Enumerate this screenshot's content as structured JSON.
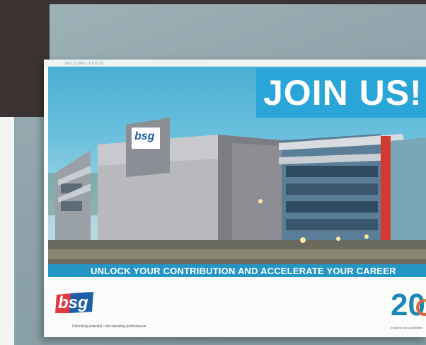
{
  "header": {
    "text": "WELCOME | JOIN US"
  },
  "hero": {
    "title": "JOIN US!"
  },
  "building_sign": {
    "text": "bsg"
  },
  "banner": {
    "text": "UNLOCK YOUR CONTRIBUTION AND ACCELERATE YOUR CAREER"
  },
  "logo": {
    "text": "bsg"
  },
  "tagline": {
    "text": "Unlocking potential » Accelerating performance"
  },
  "anniversary": {
    "text": "20",
    "subtext": "Enabling new possibilities"
  },
  "colors": {
    "brand_blue": "#2aa5d8",
    "banner_blue": "#2496c6",
    "logo_red": "#e03a3e",
    "logo_blue": "#1d5ea8"
  }
}
